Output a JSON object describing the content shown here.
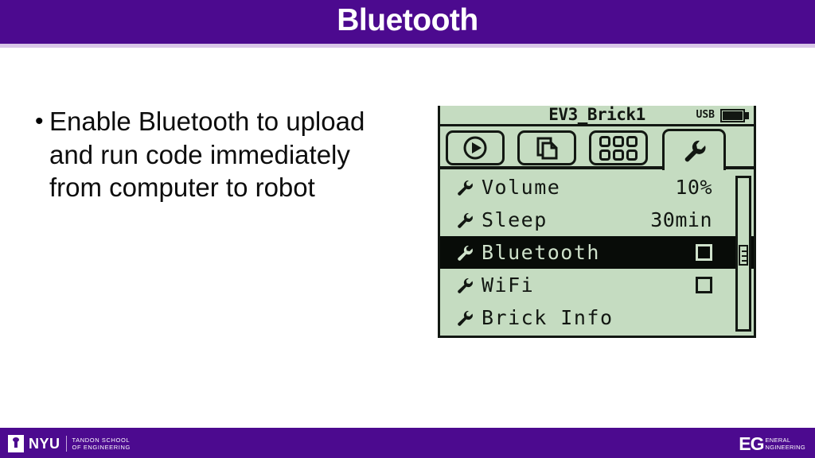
{
  "slide": {
    "title": "Bluetooth",
    "header_color": "#4c0a8f",
    "header_underline_color": "#d9c6e8",
    "background_color": "#ffffff"
  },
  "body": {
    "bullets": [
      {
        "marker": "•",
        "text": "Enable Bluetooth to upload and run code immediately from computer to robot"
      }
    ]
  },
  "ev3_screen": {
    "lcd_color": "#c5dcc1",
    "ink_color": "#121712",
    "status": {
      "brick_name": "EV3_Brick1",
      "connection": "USB",
      "battery_level_icon": "battery-full-icon"
    },
    "tabs": [
      {
        "name": "run-recent-tab",
        "icon": "play-circle-icon",
        "active": false
      },
      {
        "name": "file-navigation-tab",
        "icon": "file-pages-icon",
        "active": false
      },
      {
        "name": "brick-apps-tab",
        "icon": "app-grid-icon",
        "active": false
      },
      {
        "name": "settings-tab",
        "icon": "wrench-icon",
        "active": true
      }
    ],
    "menu": [
      {
        "icon": "wrench-icon",
        "label": "Volume",
        "value": "10%",
        "control": "value",
        "selected": false
      },
      {
        "icon": "wrench-icon",
        "label": "Sleep",
        "value": "30min",
        "control": "value",
        "selected": false
      },
      {
        "icon": "wrench-icon",
        "label": "Bluetooth",
        "value": "",
        "control": "checkbox",
        "checked": false,
        "selected": true
      },
      {
        "icon": "wrench-icon",
        "label": "WiFi",
        "value": "",
        "control": "checkbox",
        "checked": false,
        "selected": false
      },
      {
        "icon": "wrench-icon",
        "label": "Brick Info",
        "value": "",
        "control": "none",
        "selected": false
      }
    ],
    "scrollbar": {
      "name": "settings-scrollbar",
      "thumb_position_percent": 43
    }
  },
  "footer": {
    "nyu": {
      "wordmark": "NYU",
      "line1": "TANDON SCHOOL",
      "line2": "OF ENGINEERING",
      "icon": "nyu-torch-icon"
    },
    "eg": {
      "mark": "EG",
      "line1": "ENERAL",
      "line2": "NGINEERING"
    }
  }
}
